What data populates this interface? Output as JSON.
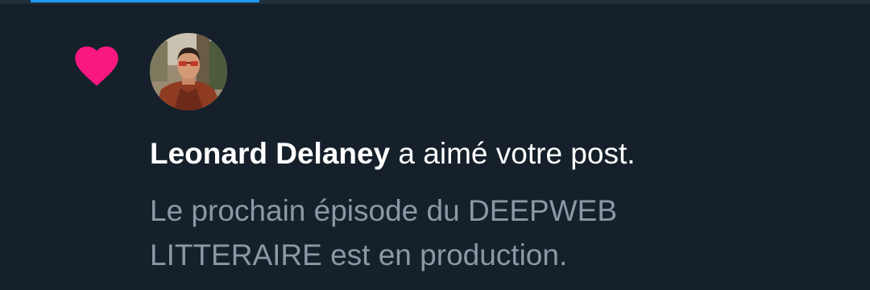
{
  "notification": {
    "type_icon": "heart-icon",
    "user_avatar": "avatar",
    "user_name": "Leonard Delaney",
    "action_text": " a aimé votre post.",
    "post_excerpt_line1": "Le prochain épisode du DEEPWEB",
    "post_excerpt_line2": "LITTERAIRE est en production."
  },
  "colors": {
    "background": "#15202b",
    "heart": "#f91880",
    "primary_text": "#ffffff",
    "secondary_text": "#8b98a5",
    "accent": "#1d9bf0"
  }
}
